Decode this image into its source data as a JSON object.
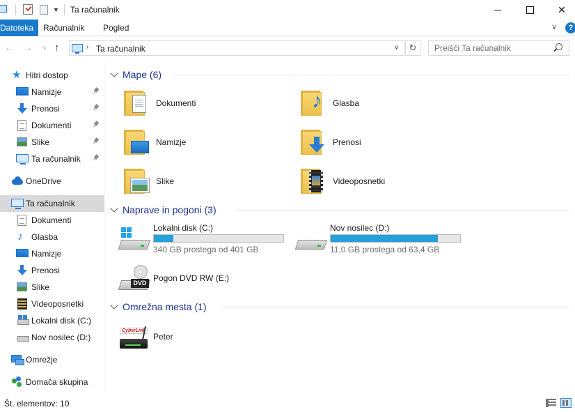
{
  "window": {
    "title": "Ta računalnik"
  },
  "ribbon": {
    "tabs": [
      "Datoteka",
      "Računalnik",
      "Pogled"
    ]
  },
  "address": {
    "path": "Ta računalnik",
    "search_placeholder": "Preišči Ta računalnik"
  },
  "sidebar": {
    "items": [
      {
        "label": "Hitri dostop",
        "icon": "star-icon",
        "pinned": false
      },
      {
        "label": "Namizje",
        "icon": "desktop-icon",
        "pinned": true
      },
      {
        "label": "Prenosi",
        "icon": "download-icon",
        "pinned": true
      },
      {
        "label": "Dokumenti",
        "icon": "document-icon",
        "pinned": true
      },
      {
        "label": "Slike",
        "icon": "picture-icon",
        "pinned": true
      },
      {
        "label": "Ta računalnik",
        "icon": "computer-icon",
        "pinned": true
      },
      {
        "label": "OneDrive",
        "icon": "cloud-icon",
        "pinned": false
      },
      {
        "label": "Ta računalnik",
        "icon": "computer-icon",
        "selected": true
      },
      {
        "label": "Dokumenti",
        "icon": "document-icon"
      },
      {
        "label": "Glasba",
        "icon": "music-icon"
      },
      {
        "label": "Namizje",
        "icon": "desktop-icon"
      },
      {
        "label": "Prenosi",
        "icon": "download-icon"
      },
      {
        "label": "Slike",
        "icon": "picture-icon"
      },
      {
        "label": "Videoposnetki",
        "icon": "video-icon"
      },
      {
        "label": "Lokalni disk (C:)",
        "icon": "drive-icon"
      },
      {
        "label": "Nov nosilec (D:)",
        "icon": "drive-icon"
      },
      {
        "label": "Omrežje",
        "icon": "network-icon"
      },
      {
        "label": "Domača skupina",
        "icon": "homegroup-icon"
      }
    ]
  },
  "groups": {
    "folders": {
      "title": "Mape (6)",
      "items": [
        "Dokumenti",
        "Glasba",
        "Namizje",
        "Prenosi",
        "Slike",
        "Videoposnetki"
      ]
    },
    "drives": {
      "title": "Naprave in pogoni (3)",
      "items": [
        {
          "name": "Lokalni disk (C:)",
          "free": "340 GB prostega od 401 GB",
          "used_fraction": 0.15
        },
        {
          "name": "Nov nosilec (D:)",
          "free": "11,0 GB prostega od 63,4 GB",
          "used_fraction": 0.83
        },
        {
          "name": "Pogon DVD RW (E:)",
          "badge": "DVD"
        }
      ]
    },
    "network": {
      "title": "Omrežna mesta (1)",
      "items": [
        {
          "name": "Peter",
          "brand": "CyberLink"
        }
      ]
    }
  },
  "status": {
    "count": "Št. elementov: 10"
  },
  "colors": {
    "accent": "#1979ca",
    "group_title": "#1e3287",
    "drive_bar": "#26a0da",
    "selection": "#d9d9d9"
  }
}
